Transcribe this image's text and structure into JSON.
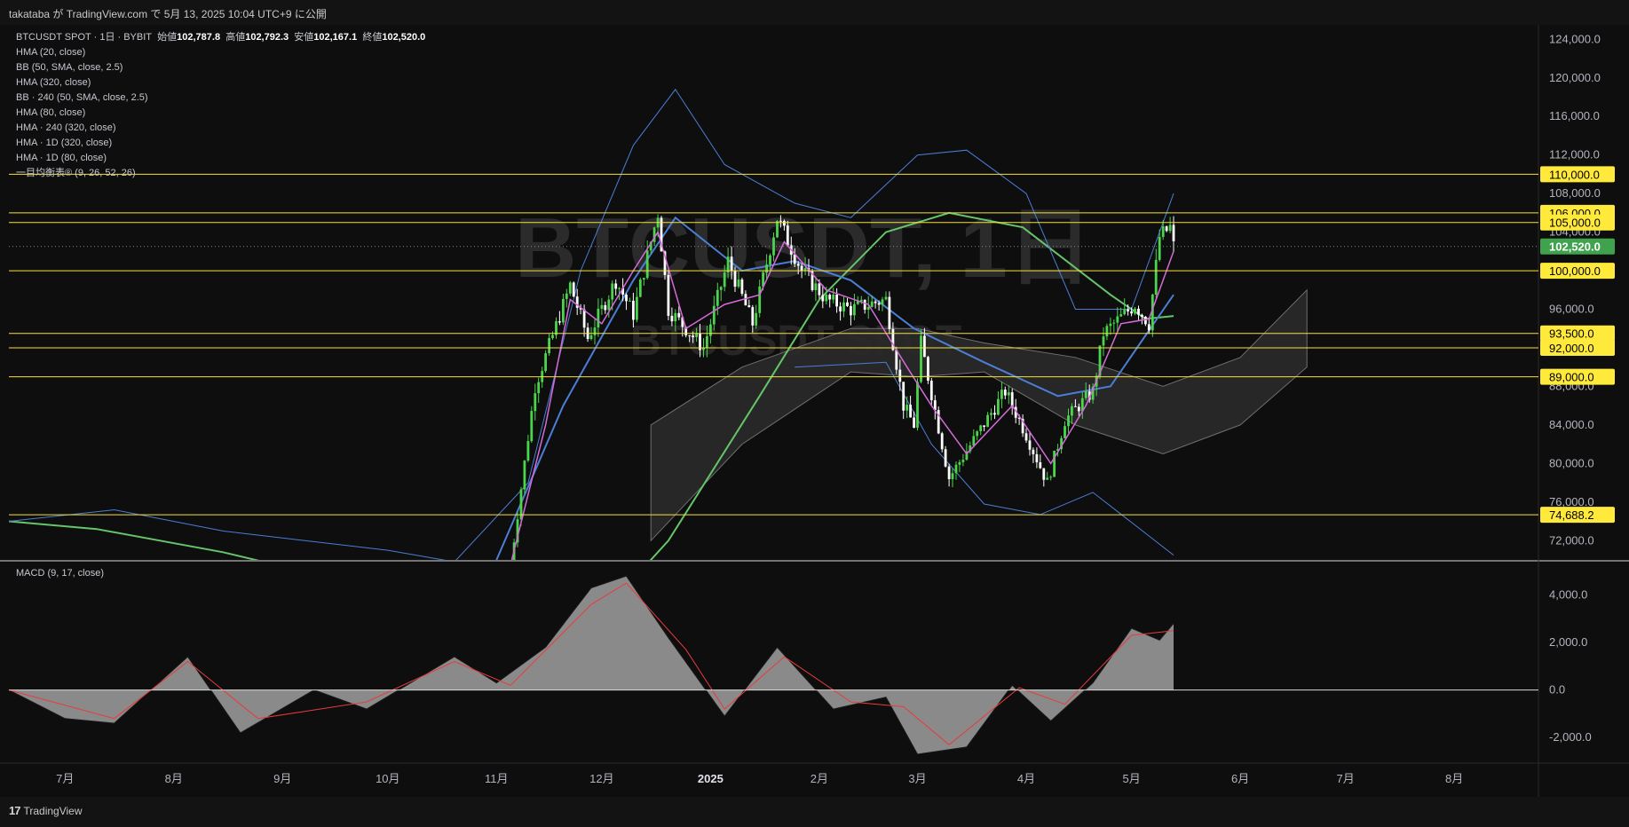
{
  "header": {
    "publish_text": "takataba が TradingView.com で 5月 13, 2025 10:04 UTC+9 に公開"
  },
  "legend": {
    "symbol": "BTCUSDT SPOT · 1日 · BYBIT",
    "open_label": "始値",
    "open": "102,787.8",
    "high_label": "高値",
    "high": "102,792.3",
    "low_label": "安値",
    "low": "102,167.1",
    "close_label": "終値",
    "close": "102,520.0",
    "indicators": [
      "HMA (20, close)",
      "BB (50, SMA, close, 2.5)",
      "HMA (320, close)",
      "BB · 240 (50, SMA, close, 2.5)",
      "HMA (80, close)",
      "HMA · 240 (320, close)",
      "HMA · 1D (320, close)",
      "HMA · 1D (80, close)",
      "一目均衡表® (9, 26, 52, 26)"
    ]
  },
  "watermark": {
    "main": "BTCUSDT, 1日",
    "sub": "BTCUSDT SPOT"
  },
  "macd_label": "MACD (9, 17, close)",
  "footer": {
    "brand": "TradingView"
  },
  "colors": {
    "background": "#0e0e0e",
    "up_candle": "#4cd44c",
    "down_candle": "#ffffff",
    "level_line": "#f7e13b",
    "level_label_bg": "#ffe93b",
    "last_price_bg": "#3fa34d",
    "bb_line": "#4b7ed6",
    "hma20": "#d46bd8",
    "hma_long": "#66c46a",
    "macd_hist": "#8a8a8a",
    "macd_signal": "#e83b3b"
  },
  "chart_data": [
    {
      "type": "candlestick",
      "x_axis": {
        "labels": [
          "7月",
          "8月",
          "9月",
          "10月",
          "11月",
          "12月",
          "2025",
          "2月",
          "3月",
          "4月",
          "5月",
          "6月",
          "7月",
          "8月"
        ],
        "start": "2024-06-15",
        "end": "2025-08-25"
      },
      "y_axis": {
        "ticks": [
          "124,000.0",
          "120,000.0",
          "116,000.0",
          "112,000.0",
          "108,000.0",
          "104,000.0",
          "100,000.0",
          "96,000.0",
          "92,000.0",
          "88,000.0",
          "84,000.0",
          "80,000.0",
          "76,000.0",
          "72,000.0"
        ],
        "range": [
          70000,
          125500
        ]
      },
      "horizontal_levels": [
        {
          "value": 110000,
          "label": "110,000.0"
        },
        {
          "value": 106000,
          "label": "106,000.0"
        },
        {
          "value": 105000,
          "label": "105,000.0"
        },
        {
          "value": 100000,
          "label": "100,000.0"
        },
        {
          "value": 93500,
          "label": "93,500.0"
        },
        {
          "value": 92000,
          "label": "92,000.0"
        },
        {
          "value": 89000,
          "label": "89,000.0"
        },
        {
          "value": 74688.2,
          "label": "74,688.2"
        }
      ],
      "last_price": {
        "value": 102520,
        "label": "102,520.0"
      },
      "price_path": [
        [
          "2024-11-05",
          69500
        ],
        [
          "2024-11-12",
          88000
        ],
        [
          "2024-11-22",
          98500
        ],
        [
          "2024-11-27",
          93000
        ],
        [
          "2024-12-05",
          99000
        ],
        [
          "2024-12-10",
          95500
        ],
        [
          "2024-12-17",
          106000
        ],
        [
          "2024-12-20",
          96000
        ],
        [
          "2024-12-30",
          92000
        ],
        [
          "2025-01-06",
          101000
        ],
        [
          "2025-01-13",
          94500
        ],
        [
          "2025-01-20",
          105500
        ],
        [
          "2025-01-27",
          100000
        ],
        [
          "2025-02-03",
          97000
        ],
        [
          "2025-02-10",
          96000
        ],
        [
          "2025-02-20",
          97000
        ],
        [
          "2025-02-25",
          86000
        ],
        [
          "2025-02-28",
          84000
        ],
        [
          "2025-03-02",
          92500
        ],
        [
          "2025-03-10",
          78500
        ],
        [
          "2025-03-18",
          83000
        ],
        [
          "2025-03-26",
          87500
        ],
        [
          "2025-04-01",
          83000
        ],
        [
          "2025-04-07",
          78000
        ],
        [
          "2025-04-12",
          84500
        ],
        [
          "2025-04-20",
          87500
        ],
        [
          "2025-04-23",
          93500
        ],
        [
          "2025-05-02",
          96500
        ],
        [
          "2025-05-06",
          94500
        ],
        [
          "2025-05-09",
          103500
        ],
        [
          "2025-05-12",
          104500
        ],
        [
          "2025-05-13",
          102520
        ]
      ],
      "bb_upper": [
        [
          "2024-06-15",
          74000
        ],
        [
          "2024-07-15",
          75200
        ],
        [
          "2024-08-15",
          73000
        ],
        [
          "2024-10-01",
          71000
        ],
        [
          "2024-10-20",
          69800
        ],
        [
          "2024-11-10",
          78000
        ],
        [
          "2024-11-25",
          100000
        ],
        [
          "2024-12-10",
          113000
        ],
        [
          "2024-12-22",
          118800
        ],
        [
          "2025-01-05",
          111000
        ],
        [
          "2025-01-25",
          107000
        ],
        [
          "2025-02-10",
          105500
        ],
        [
          "2025-03-01",
          112000
        ],
        [
          "2025-03-15",
          112500
        ],
        [
          "2025-04-01",
          108000
        ],
        [
          "2025-04-15",
          96000
        ],
        [
          "2025-05-01",
          96000
        ],
        [
          "2025-05-13",
          108000
        ]
      ],
      "bb_lower": [
        [
          "2025-01-25",
          90000
        ],
        [
          "2025-02-20",
          90500
        ],
        [
          "2025-03-05",
          82000
        ],
        [
          "2025-03-20",
          75800
        ],
        [
          "2025-04-05",
          74700
        ],
        [
          "2025-04-20",
          77000
        ],
        [
          "2025-05-13",
          70500
        ]
      ],
      "hma20": [
        [
          "2024-11-05",
          69500
        ],
        [
          "2024-11-15",
          84000
        ],
        [
          "2024-11-22",
          97000
        ],
        [
          "2024-12-01",
          94500
        ],
        [
          "2024-12-10",
          100000
        ],
        [
          "2024-12-17",
          104000
        ],
        [
          "2024-12-25",
          94000
        ],
        [
          "2025-01-05",
          96500
        ],
        [
          "2025-01-15",
          97500
        ],
        [
          "2025-01-22",
          103000
        ],
        [
          "2025-02-03",
          98000
        ],
        [
          "2025-02-15",
          96500
        ],
        [
          "2025-02-26",
          90000
        ],
        [
          "2025-03-05",
          86000
        ],
        [
          "2025-03-15",
          81000
        ],
        [
          "2025-03-28",
          86000
        ],
        [
          "2025-04-08",
          80000
        ],
        [
          "2025-04-18",
          86000
        ],
        [
          "2025-04-28",
          94500
        ],
        [
          "2025-05-06",
          95000
        ],
        [
          "2025-05-13",
          102000
        ]
      ]
    },
    {
      "type": "macd",
      "name": "MACD (9, 17, close)",
      "y_axis": {
        "ticks": [
          "4,000.0",
          "2,000.0",
          "0.0",
          "-2,000.0"
        ],
        "range": [
          -3000,
          5400
        ]
      },
      "histogram": [
        [
          "2024-06-15",
          0
        ],
        [
          "2024-07-01",
          -1200
        ],
        [
          "2024-07-15",
          -1400
        ],
        [
          "2024-08-05",
          1400
        ],
        [
          "2024-08-20",
          -1800
        ],
        [
          "2024-09-10",
          0
        ],
        [
          "2024-09-25",
          -800
        ],
        [
          "2024-10-20",
          1400
        ],
        [
          "2024-11-01",
          300
        ],
        [
          "2024-11-15",
          1800
        ],
        [
          "2024-11-28",
          4300
        ],
        [
          "2024-12-08",
          4800
        ],
        [
          "2024-12-20",
          2200
        ],
        [
          "2025-01-05",
          -1100
        ],
        [
          "2025-01-20",
          1800
        ],
        [
          "2025-02-05",
          -800
        ],
        [
          "2025-02-20",
          -300
        ],
        [
          "2025-03-01",
          -2700
        ],
        [
          "2025-03-15",
          -2400
        ],
        [
          "2025-03-28",
          200
        ],
        [
          "2025-04-08",
          -1300
        ],
        [
          "2025-04-20",
          300
        ],
        [
          "2025-05-01",
          2600
        ],
        [
          "2025-05-09",
          2100
        ],
        [
          "2025-05-13",
          2800
        ]
      ],
      "signal": [
        [
          "2024-06-15",
          0
        ],
        [
          "2024-07-15",
          -1200
        ],
        [
          "2024-08-05",
          1200
        ],
        [
          "2024-08-25",
          -1200
        ],
        [
          "2024-09-25",
          -500
        ],
        [
          "2024-10-20",
          1200
        ],
        [
          "2024-11-05",
          200
        ],
        [
          "2024-11-28",
          3600
        ],
        [
          "2024-12-08",
          4500
        ],
        [
          "2024-12-25",
          1700
        ],
        [
          "2025-01-05",
          -800
        ],
        [
          "2025-01-22",
          1400
        ],
        [
          "2025-02-10",
          -500
        ],
        [
          "2025-02-25",
          -700
        ],
        [
          "2025-03-10",
          -2300
        ],
        [
          "2025-03-30",
          100
        ],
        [
          "2025-04-12",
          -600
        ],
        [
          "2025-05-01",
          2300
        ],
        [
          "2025-05-13",
          2500
        ]
      ]
    }
  ]
}
